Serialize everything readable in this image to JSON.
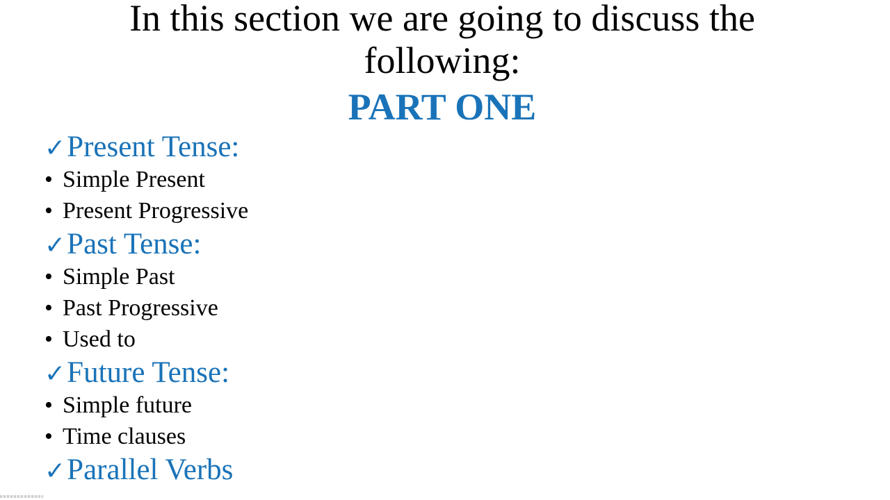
{
  "colors": {
    "accent": "#1a73b8",
    "text": "#000000",
    "background": "#ffffff"
  },
  "slide": {
    "title_line1": "In this section we are going to discuss the",
    "title_line2": "following:",
    "part_label": "PART ONE",
    "check_icon": "✓",
    "bullet_icon": "•",
    "sections": [
      {
        "heading": "Present Tense:",
        "items": [
          "Simple Present",
          "Present Progressive"
        ]
      },
      {
        "heading": "Past Tense:",
        "items": [
          "Simple Past",
          "Past Progressive",
          "Used to"
        ]
      },
      {
        "heading": "Future Tense:",
        "items": [
          "Simple future",
          "Time clauses"
        ]
      },
      {
        "heading": "Parallel Verbs",
        "items": []
      }
    ]
  }
}
